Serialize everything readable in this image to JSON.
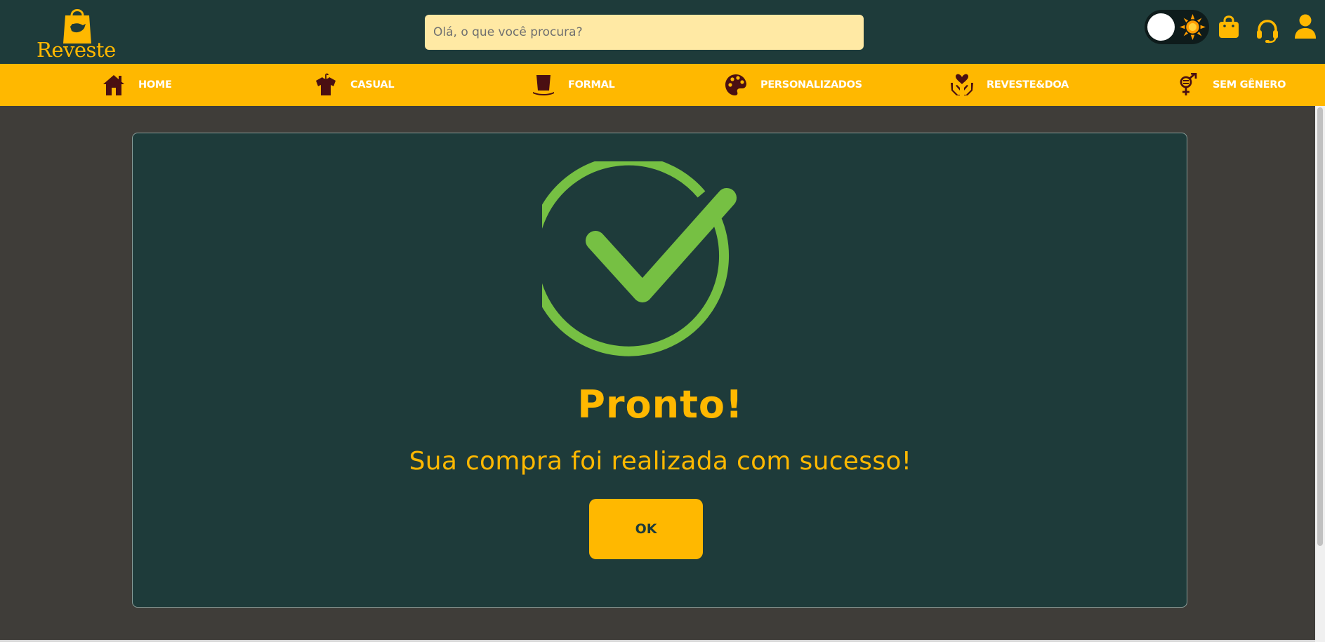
{
  "header": {
    "logo_text": "Reveste",
    "search": {
      "placeholder": "Olá, o que você procura?",
      "value": ""
    },
    "icons": {
      "theme_toggle": "theme-toggle",
      "sun": "sun-icon",
      "bag": "shopping-bag-icon",
      "support": "headset-icon",
      "user": "user-icon"
    }
  },
  "nav": {
    "items": [
      {
        "label": "HOME",
        "icon": "home-icon"
      },
      {
        "label": "CASUAL",
        "icon": "shirt-icon"
      },
      {
        "label": "FORMAL",
        "icon": "top-hat-icon"
      },
      {
        "label": "PERSONALIZADOS",
        "icon": "palette-icon"
      },
      {
        "label": "REVESTE&DOA",
        "icon": "hands-heart-icon"
      },
      {
        "label": "SEM GÊNERO",
        "icon": "gender-icon"
      }
    ]
  },
  "modal": {
    "icon": "check-circle-icon",
    "title": "Pronto!",
    "message": "Sua compra foi realizada com sucesso!",
    "button_label": "OK"
  },
  "colors": {
    "header_bg": "#1e3b3a",
    "accent": "#ffb800",
    "page_bg": "#3f3d39",
    "search_bg": "#ffe9a4",
    "success_green": "#76c043",
    "nav_icon": "#4a0f12"
  }
}
